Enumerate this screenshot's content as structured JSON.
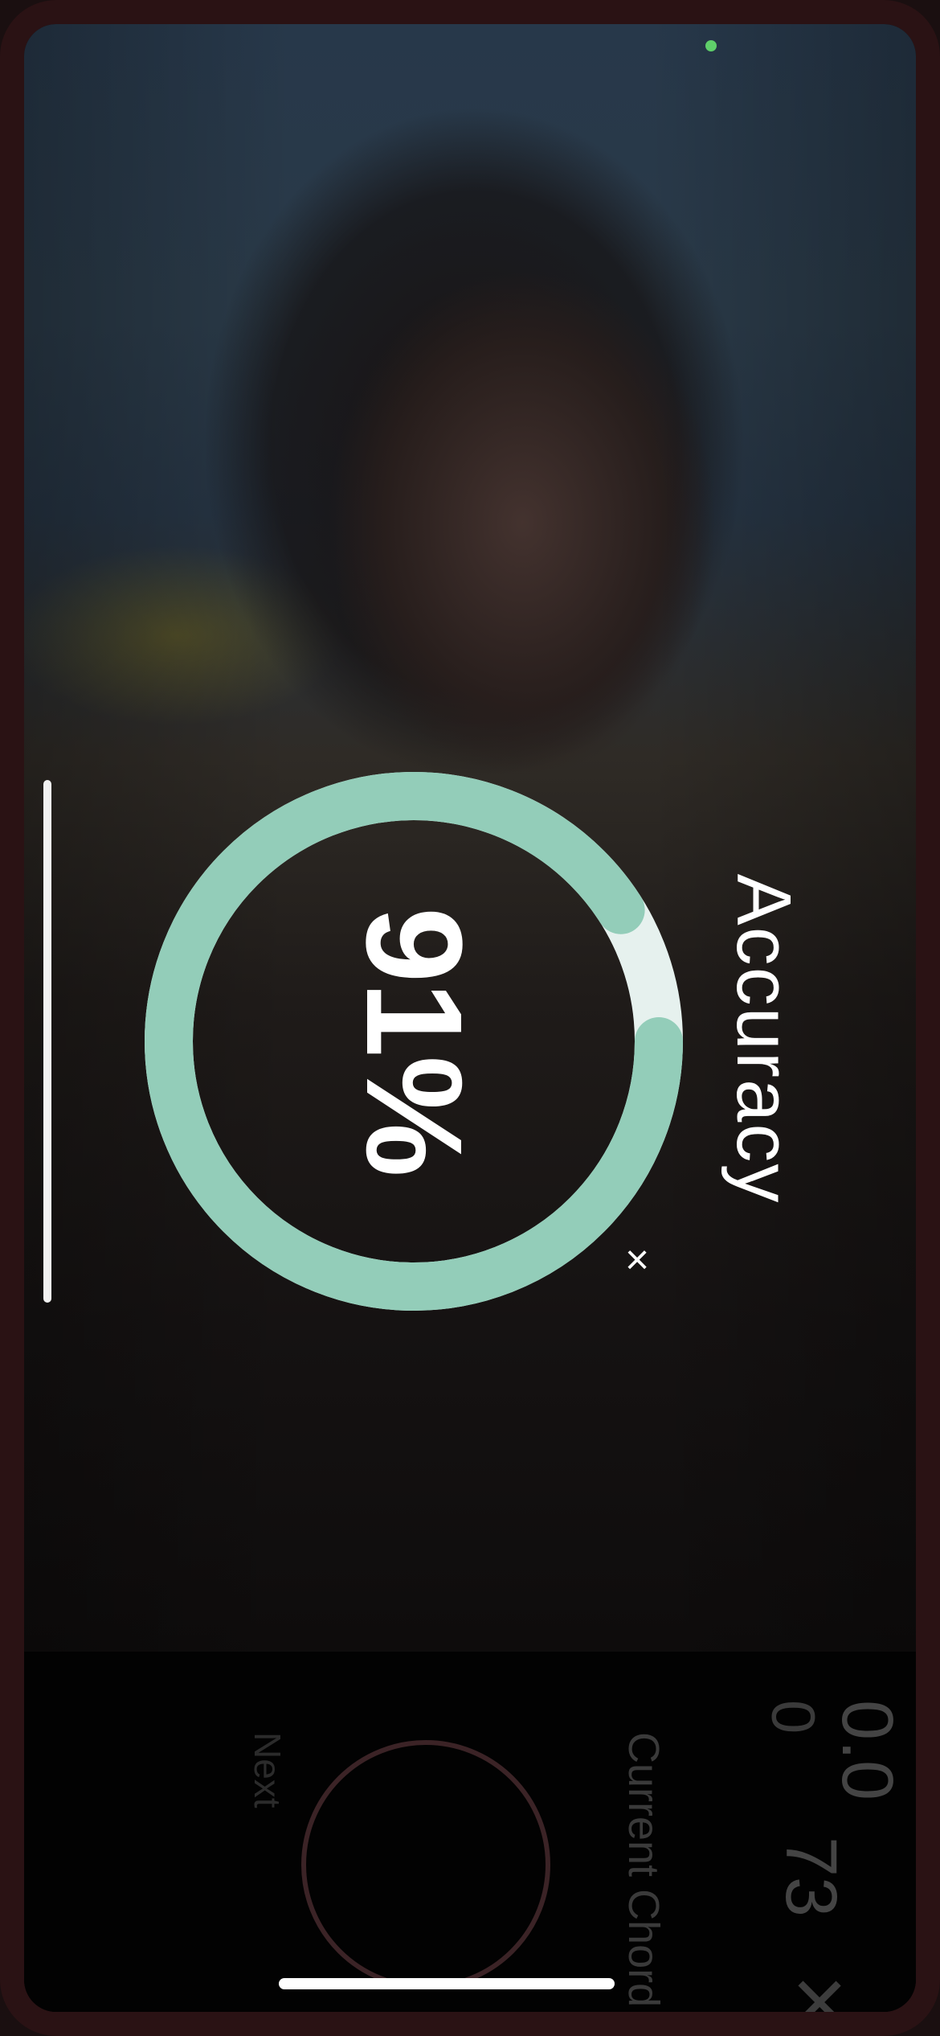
{
  "accuracy": {
    "label": "Accuracy",
    "value": "91%",
    "percent": 91
  },
  "overlay": {
    "close_glyph": "×",
    "close_icon": "close-icon"
  },
  "controls": {
    "next_label": "Next",
    "current_chord_label": "Current Chord",
    "value_zero": "0",
    "value_a": "0.0",
    "value_b": "73",
    "close_glyph": "×",
    "close_icon": "close-icon"
  },
  "colors": {
    "ring": "#93cdb9",
    "ring_track": "#e6f1ee",
    "status_dot": "#5fcf6a",
    "record_ring": "#3b2326"
  }
}
